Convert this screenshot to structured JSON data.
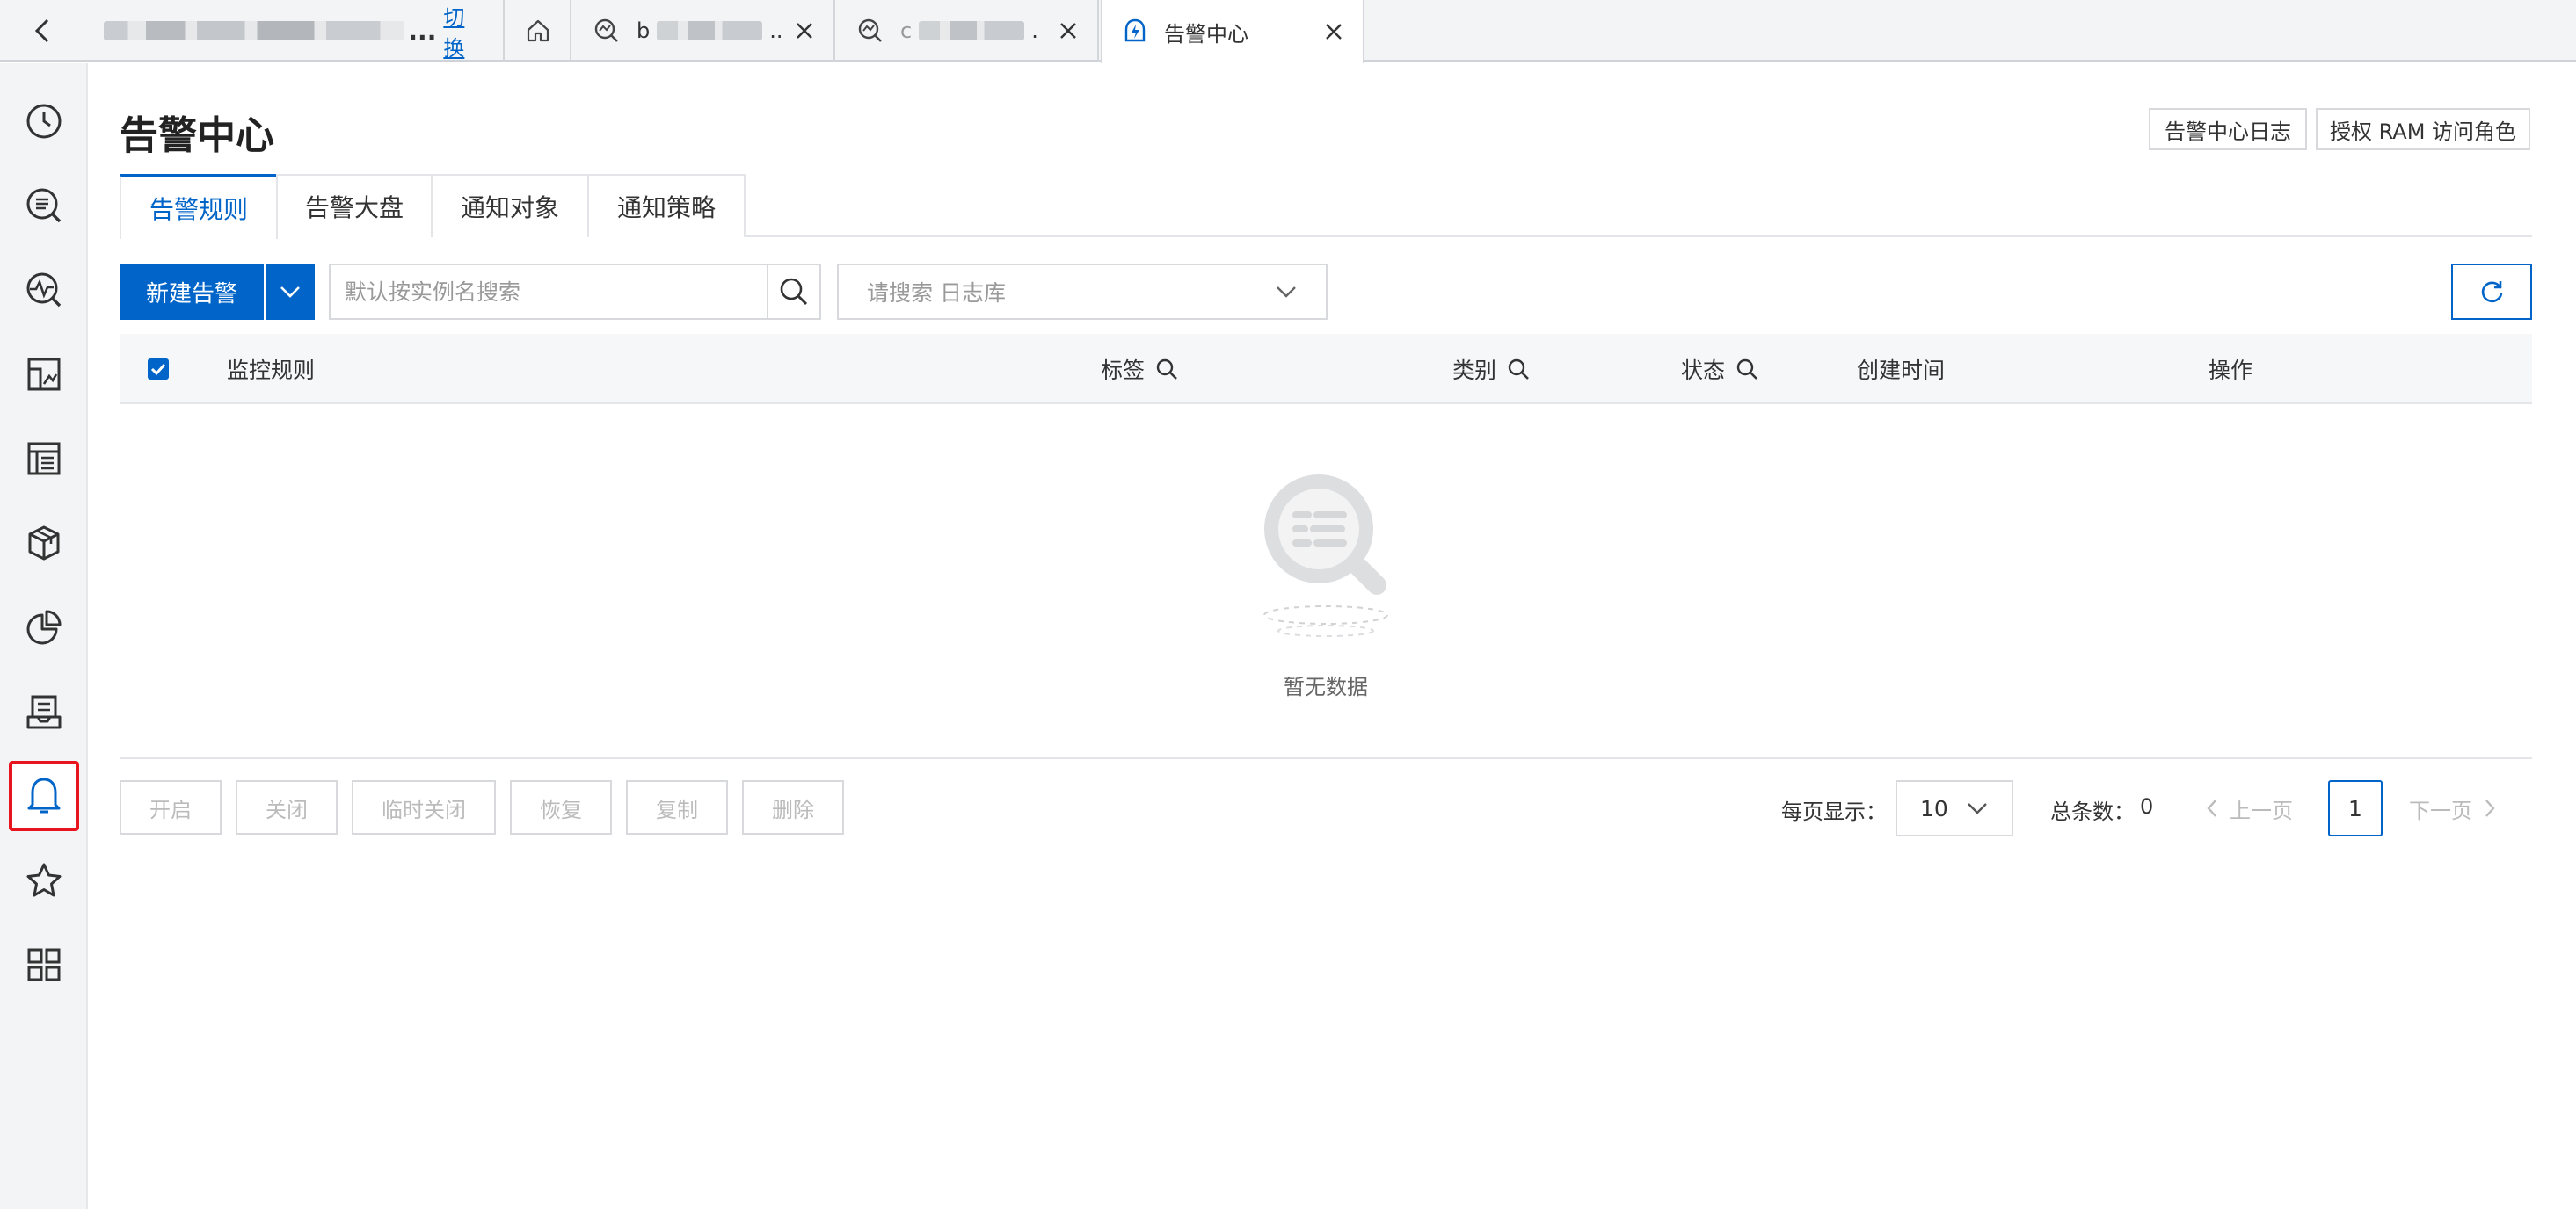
{
  "top_tabs": {
    "project_switch": "切换",
    "project_ellipsis": "...",
    "tab_b_prefix": "b",
    "tab_b_trail": "..",
    "tab_c_prefix": "c",
    "tab_c_trail": ".",
    "alert_tab_label": "告警中心"
  },
  "sidebar": {
    "items": [
      {
        "icon": "clock-icon"
      },
      {
        "icon": "search-list-icon"
      },
      {
        "icon": "monitor-search-icon"
      },
      {
        "icon": "dashboard-icon"
      },
      {
        "icon": "report-icon"
      },
      {
        "icon": "box-icon"
      },
      {
        "icon": "pie-chart-icon"
      },
      {
        "icon": "inbox-icon"
      },
      {
        "icon": "bell-icon",
        "active": true
      },
      {
        "icon": "star-icon"
      },
      {
        "icon": "grid-icon"
      }
    ]
  },
  "header": {
    "title": "告警中心",
    "log_button": "告警中心日志",
    "ram_button": "授权 RAM 访问角色"
  },
  "tabs": [
    "告警规则",
    "告警大盘",
    "通知对象",
    "通知策略"
  ],
  "toolbar": {
    "new_alert": "新建告警",
    "search_placeholder": "默认按实例名搜索",
    "logstore_placeholder": "请搜索 日志库"
  },
  "table": {
    "columns": [
      "监控规则",
      "标签",
      "类别",
      "状态",
      "创建时间",
      "操作"
    ],
    "empty_text": "暂无数据"
  },
  "actions": [
    "开启",
    "关闭",
    "临时关闭",
    "恢复",
    "复制",
    "删除"
  ],
  "pagination": {
    "page_size_label": "每页显示：",
    "page_size": "10",
    "total_label": "总条数：",
    "total": "0",
    "prev": "上一页",
    "next": "下一页",
    "current_page": "1"
  },
  "colors": {
    "primary": "#0064c8",
    "active_outline": "#e8141f"
  }
}
